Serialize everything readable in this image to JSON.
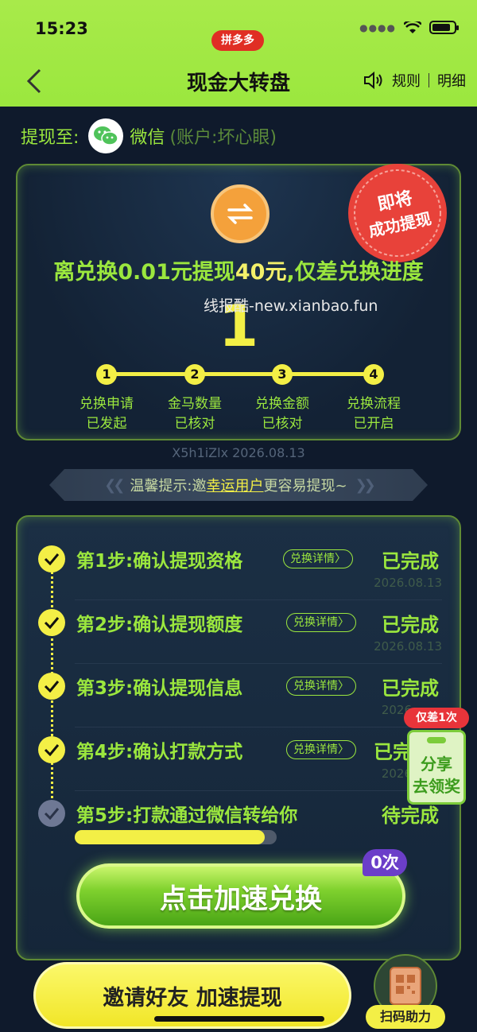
{
  "status_bar": {
    "time": "15:23",
    "app_badge": "拼多多"
  },
  "nav": {
    "title": "现金大转盘",
    "rules": "规则",
    "details": "明细"
  },
  "withdraw_to": {
    "label": "提现至:",
    "channel": "微信",
    "account": "(账户:坏心眼)"
  },
  "progress_card": {
    "stamp_line1": "即将",
    "stamp_line2": "成功提现",
    "headline_prefix": "离兑换0.01元提现",
    "headline_amount": "40元",
    "headline_suffix": ",仅差兑换进度",
    "watermark": "线报酷-new.xianbao.fun",
    "remaining": "1",
    "steps": [
      {
        "num": "1",
        "line1": "兑换申请",
        "line2": "已发起"
      },
      {
        "num": "2",
        "line1": "金马数量",
        "line2": "已核对"
      },
      {
        "num": "3",
        "line1": "兑换金额",
        "line2": "已核对"
      },
      {
        "num": "4",
        "line1": "兑换流程",
        "line2": "已开启"
      }
    ]
  },
  "code_line": "X5h1iZlx 2026.08.13",
  "tip": {
    "prefix": "温馨提示:邀",
    "highlight": "幸运用户",
    "suffix": "更容易提现~"
  },
  "steps_card": {
    "steps": [
      {
        "title": "第1步:确认提现资格",
        "detail": "兑换详情",
        "status": "已完成",
        "date": "2026.08.13"
      },
      {
        "title": "第2步:确认提现额度",
        "detail": "兑换详情",
        "status": "已完成",
        "date": "2026.08.13"
      },
      {
        "title": "第3步:确认提现信息",
        "detail": "兑换详情",
        "status": "已完成",
        "date": "2026"
      },
      {
        "title": "第4步:确认打款方式",
        "detail": "兑换详情",
        "status": "已完",
        "date": "2026"
      },
      {
        "title": "第5步:打款通过微信转给你",
        "status": "待完成"
      }
    ],
    "step5_progress": 0.94,
    "accelerate_button": "点击加速兑换",
    "count_badge": "0次"
  },
  "share_float": {
    "tag": "仅差1次",
    "line1": "分享",
    "line2": "去领奖"
  },
  "invite_button": "邀请好友 加速提现",
  "scan_button": "扫码助力",
  "colors": {
    "accent_green": "#9be73e",
    "accent_yellow": "#f3ef46",
    "background": "#0f1a2c"
  }
}
